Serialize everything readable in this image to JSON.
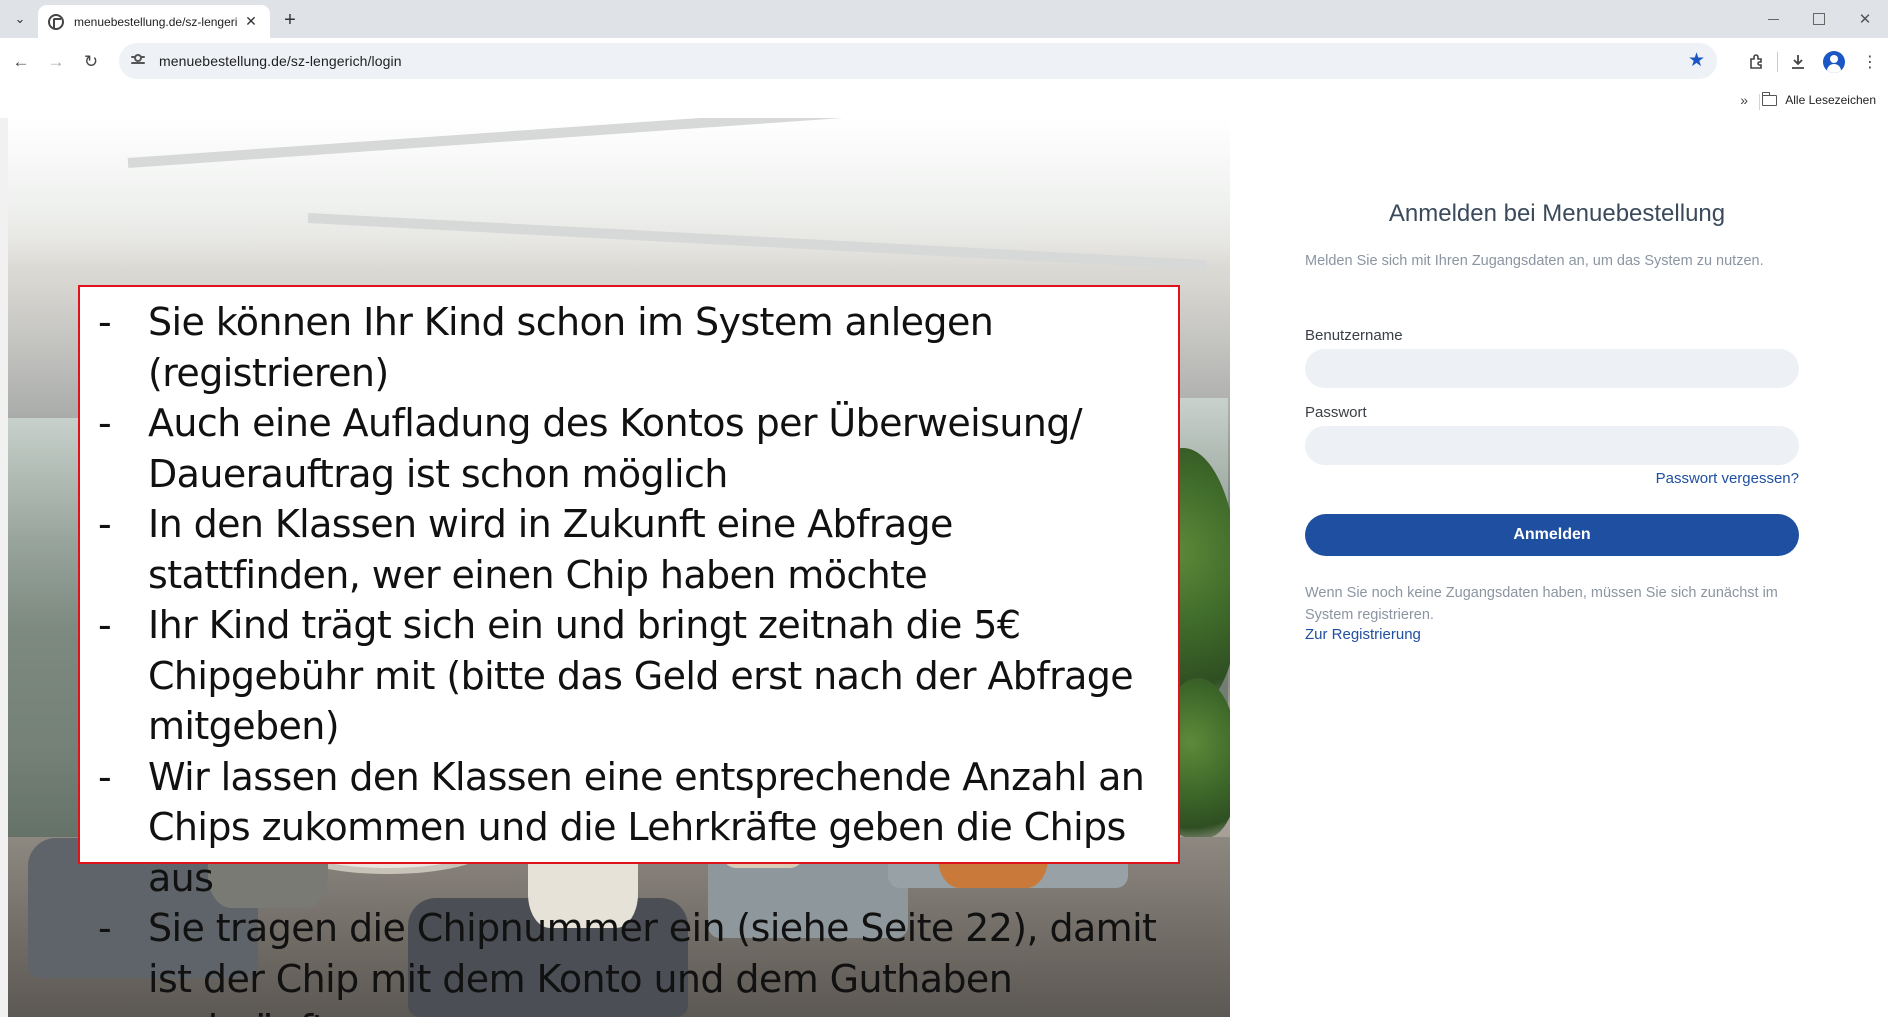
{
  "browser": {
    "tab_title": "menuebestellung.de/sz-lengeri",
    "tab_close": "✕",
    "new_tab": "+",
    "url": "menuebestellung.de/sz-lengerich/login",
    "bookmarks_overflow": "»",
    "all_bookmarks_label": "Alle Lesezeichen"
  },
  "overlay": {
    "bullets": [
      {
        "dash": "-",
        "text": "Sie können Ihr Kind schon im System anlegen (registrieren)"
      },
      {
        "dash": "-",
        "text": "Auch eine Aufladung des Kontos per Überweisung/ Dauerauftrag ist schon möglich"
      },
      {
        "dash": "-",
        "text": "In den Klassen wird in Zukunft eine Abfrage stattfinden, wer einen Chip haben möchte"
      },
      {
        "dash": "-",
        "text": "Ihr Kind trägt sich ein und bringt zeitnah die 5€ Chipgebühr mit (bitte das Geld erst nach der Abfrage mitgeben)"
      },
      {
        "dash": "-",
        "text": "Wir lassen den Klassen eine entsprechende Anzahl an Chips zukommen und die Lehrkräfte geben die Chips aus"
      },
      {
        "dash": "-",
        "text": "Sie tragen die Chipnummer ein (siehe Seite 22), damit ist der Chip mit dem Konto und dem Guthaben verknüpft"
      }
    ],
    "border_color": "#e0121b"
  },
  "login": {
    "title": "Anmelden bei Menuebestellung",
    "subtitle": "Melden Sie sich mit Ihren Zugangsdaten an, um das System zu nutzen.",
    "username_label": "Benutzername",
    "username_value": "",
    "password_label": "Passwort",
    "password_value": "",
    "forgot_password": "Passwort vergessen?",
    "submit_label": "Anmelden",
    "no_account_text": "Wenn Sie noch keine Zugangsdaten haben, müssen Sie sich zunächst im System registrieren.",
    "register_link": "Zur Registrierung",
    "accent_color": "#1f4fa0"
  },
  "icons": {
    "tab_menu": "chevron-down-icon",
    "favicon": "globe-icon",
    "back": "arrow-left-icon",
    "forward": "arrow-right-icon",
    "reload": "reload-icon",
    "site_info": "tune-icon",
    "bookmark": "star-icon",
    "extensions": "puzzle-icon",
    "downloads": "download-icon",
    "profile": "profile-icon",
    "menu": "more-vert-icon",
    "folder": "folder-icon"
  }
}
